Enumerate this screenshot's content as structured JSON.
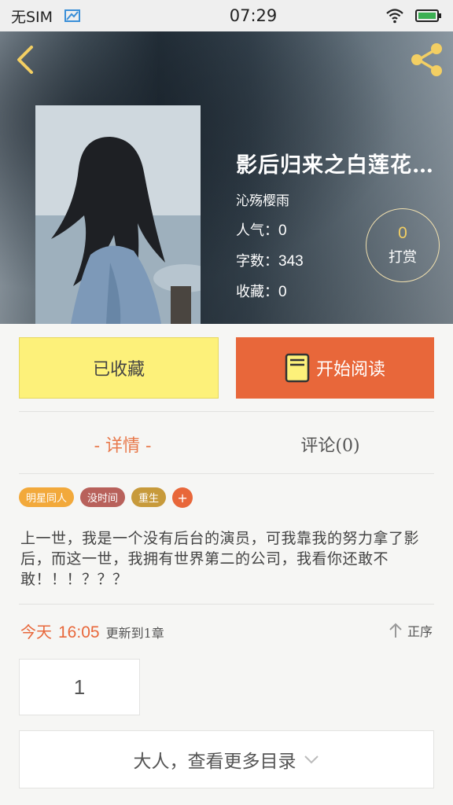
{
  "status_bar": {
    "carrier": "无SIM",
    "time": "07:29"
  },
  "book": {
    "title": "影后归来之白莲花...",
    "author": "沁殇樱雨",
    "stats": [
      {
        "label": "人气：",
        "value": "0"
      },
      {
        "label": "字数：",
        "value": "343"
      },
      {
        "label": "收藏：",
        "value": "0"
      }
    ]
  },
  "tip": {
    "count": "0",
    "label": "打赏"
  },
  "actions": {
    "collect_label": "已收藏",
    "read_label": "开始阅读"
  },
  "tabs": [
    {
      "label": "- 详情 -"
    },
    {
      "label": "评论(0)"
    }
  ],
  "tags": [
    {
      "label": "明星同人",
      "color": "#f2a93b"
    },
    {
      "label": "没时间",
      "color": "#b8615b"
    },
    {
      "label": "重生",
      "color": "#c79a3b"
    }
  ],
  "tag_add": "+",
  "synopsis": "上一世，我是一个没有后台的演员，可我靠我的努力拿了影后，而这一世，我拥有世界第二的公司，我看你还敢不敢！！！？？？",
  "update": {
    "day": "今天",
    "time": "16:05",
    "text": "更新到1章"
  },
  "sort_label": "正序",
  "chapter_number": "1",
  "more_toc_label": "大人，查看更多目录",
  "colors": {
    "accent": "#e8673a",
    "collect_bg": "#fdf17a",
    "tip_count": "#f3cf63"
  }
}
